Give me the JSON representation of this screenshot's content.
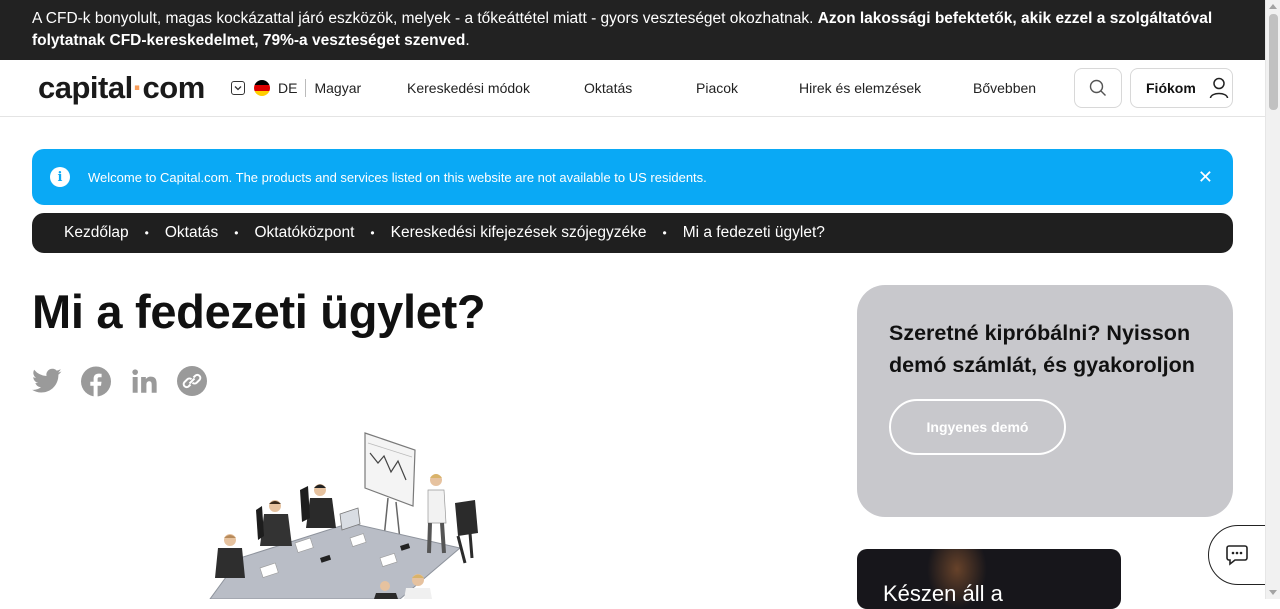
{
  "risk_banner": {
    "text_normal": "A CFD-k bonyolult, magas kockázattal járó eszközök, melyek - a tőkeáttétel miatt - gyors veszteséget okozhatnak. ",
    "text_bold": "Azon lakossági befektetők, akik ezzel a szolgáltatóval folytatnak CFD-kereskedelmet, 79%-a veszteséget szenved",
    "text_end": "."
  },
  "header": {
    "logo_part1": "capital",
    "logo_dot": "·",
    "logo_part2": "com",
    "country_code": "DE",
    "language": "Magyar",
    "nav": [
      "Kereskedési módok",
      "Oktatás",
      "Piacok",
      "Hirek és elemzések",
      "Bővebben"
    ],
    "account_label": "Fiókom"
  },
  "notice": {
    "text": "Welcome to Capital.com. The products and services listed on this website are not available to US residents.",
    "close_glyph": "✕"
  },
  "breadcrumb": {
    "items": [
      "Kezdőlap",
      "Oktatás",
      "Oktatóközpont",
      "Kereskedési kifejezések szójegyzéke",
      "Mi a fedezeti ügylet?"
    ],
    "separator": "•"
  },
  "article": {
    "title": "Mi a fedezeti ügylet?"
  },
  "demo_card": {
    "title": "Szeretné kipróbálni? Nyisson demó számlát, és gyakoroljon",
    "button_label": "Ingyenes demó"
  },
  "promo_card": {
    "title": "Készen áll a"
  },
  "colors": {
    "risk_bg": "#222222",
    "notice_bg": "#0aa9f5",
    "breadcrumb_bg": "#1f1f1f",
    "logo_dot": "#f89d5a",
    "demo_card_bg": "#c8c8cc",
    "share_icon": "#9a9a9a"
  },
  "icons": {
    "share": [
      "twitter-icon",
      "facebook-icon",
      "linkedin-icon",
      "copy-link-icon"
    ],
    "header": [
      "chevron-down-icon",
      "germany-flag-icon",
      "search-icon",
      "user-icon"
    ],
    "notice": "info-icon",
    "chat": "chat-icon"
  }
}
